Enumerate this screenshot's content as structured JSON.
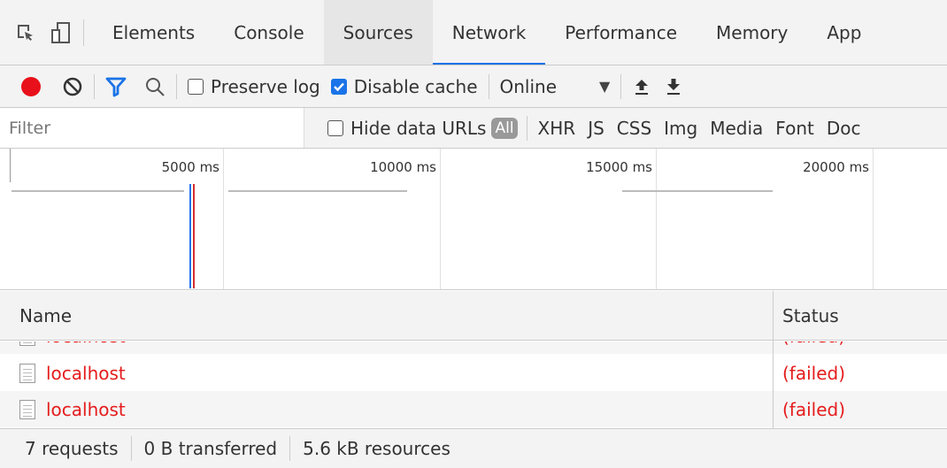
{
  "tabs": [
    {
      "label": "Elements"
    },
    {
      "label": "Console"
    },
    {
      "label": "Sources"
    },
    {
      "label": "Network"
    },
    {
      "label": "Performance"
    },
    {
      "label": "Memory"
    },
    {
      "label": "App"
    }
  ],
  "toolbar": {
    "preserve_log_label": "Preserve log",
    "preserve_log_checked": false,
    "disable_cache_label": "Disable cache",
    "disable_cache_checked": true,
    "throttling_value": "Online"
  },
  "filter": {
    "placeholder": "Filter",
    "hide_data_urls_label": "Hide data URLs",
    "all_label": "All",
    "types": [
      "XHR",
      "JS",
      "CSS",
      "Img",
      "Media",
      "Font",
      "Doc"
    ]
  },
  "overview": {
    "ticks": [
      "5000 ms",
      "10000 ms",
      "15000 ms",
      "20000 ms"
    ]
  },
  "table": {
    "columns": {
      "name": "Name",
      "status": "Status"
    },
    "rows": [
      {
        "name": "localhost",
        "status": "(failed)"
      },
      {
        "name": "localhost",
        "status": "(failed)"
      },
      {
        "name": "localhost",
        "status": "(failed)"
      }
    ]
  },
  "status_bar": {
    "requests": "7 requests",
    "transferred": "0 B transferred",
    "resources": "5.6 kB resources"
  },
  "colors": {
    "accent": "#1a73e8",
    "record": "#e8101a",
    "error_text": "#e51c1c"
  }
}
